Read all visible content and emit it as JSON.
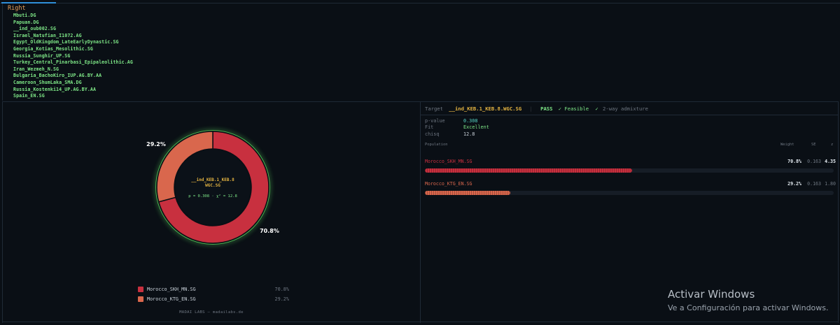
{
  "right_panel": {
    "label": "Right",
    "populations": [
      "Mbuti.DG",
      "Papuan.DG",
      "__ind_oub002.SG",
      "Israel_Natufian_I1072.AG",
      "Egypt_OldKingdom_LateEarlyDynastic.SG",
      "Georgia_Kotias_Mesolithic.SG",
      "Russia_Sunghir_UP.SG",
      "Turkey_Central_Pinarbasi_Epipaleolithic.AG",
      "Iran_Wezmeh_N.SG",
      "Bulgaria_BachoKiro_IUP.AG.BY.AA",
      "Cameroon_ShumLaka_SMA.DG",
      "Russia_Kostenki14_UP.AG.BY.AA",
      "Spain_EN.SG"
    ]
  },
  "donut": {
    "center_title": "__ind_KEB.1_KEB.8\nWGC.SG",
    "center_stats": "p = 0.308 · χ² = 12.8",
    "ring_color": "#4caf50"
  },
  "chart_data": {
    "type": "pie",
    "categories": [
      "Morocco_SKH_MN.SG",
      "Morocco_KTG_EN.SG"
    ],
    "values": [
      70.8,
      29.2
    ],
    "labels": [
      "70.8%",
      "29.2%"
    ],
    "colors": [
      "#c8303f",
      "#d9674d"
    ]
  },
  "legend": [
    {
      "name": "Morocco_SKH_MN.SG",
      "pct": "70.8%",
      "color": "#c8303f"
    },
    {
      "name": "Morocco_KTG_EN.SG",
      "pct": "29.2%",
      "color": "#d9674d"
    }
  ],
  "footer": "MADAI LABS — madailabs.de",
  "result": {
    "target_label": "Target",
    "target_name": "__ind_KEB.1_KEB.8.WGC.SG",
    "separator": "|",
    "pass": "PASS",
    "feasible": "✓ Feasible",
    "check2": "✓",
    "admixture": "2-way admixture",
    "stats": [
      {
        "key": "p-value",
        "value": "0.308",
        "tone": "teal"
      },
      {
        "key": "Fit",
        "value": "Excellent",
        "tone": "green"
      },
      {
        "key": "chisq",
        "value": "12.8",
        "tone": "plain"
      }
    ],
    "table_headers": {
      "population": "Population",
      "weight": "Weight",
      "se": "SE",
      "z": "z"
    },
    "rows": [
      {
        "population": "Morocco_SKH_MN.SG",
        "weight": "70.8%",
        "weight_fraction": 0.708,
        "se": "0.163",
        "z": "4.35",
        "color": "#c8303f"
      },
      {
        "population": "Morocco_KTG_EN.SG",
        "weight": "29.2%",
        "weight_fraction": 0.292,
        "se": "0.163",
        "z": "1.80",
        "color": "#d9674d"
      }
    ]
  },
  "watermark": {
    "title": "Activar Windows",
    "subtitle": "Ve a Configuración para activar Windows."
  }
}
